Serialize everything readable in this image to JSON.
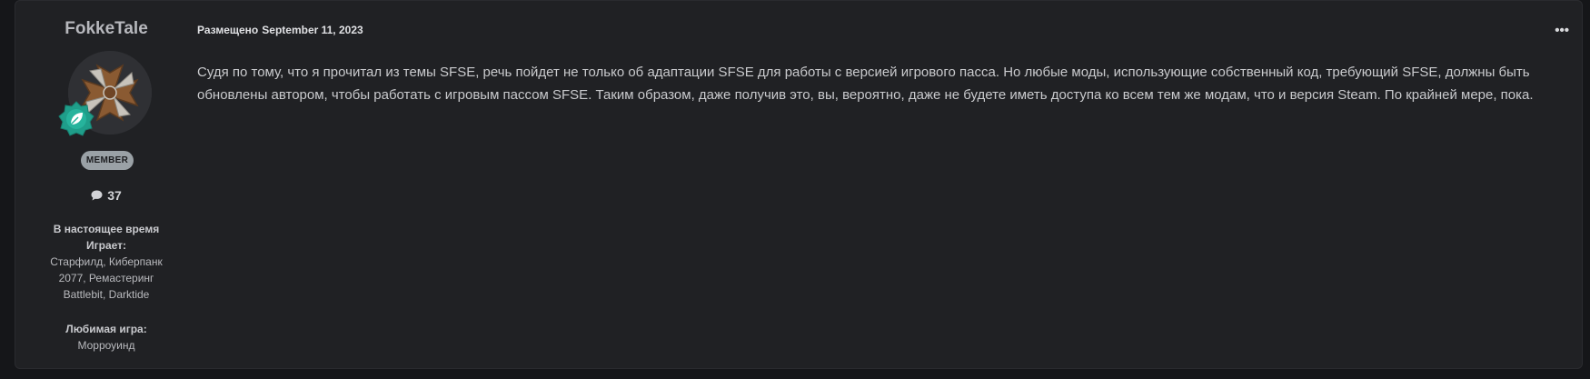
{
  "author": {
    "name": "FokkeTale",
    "avatar_icon": "ornate-cross-avatar",
    "badge_icon": "leaf-badge-icon",
    "badge_color": "#1f9e8a",
    "rank": "MEMBER",
    "post_count_icon": "comment-icon",
    "post_count": "37",
    "fields": [
      {
        "label": "В настоящее время Играет:",
        "value": "Старфилд, Киберпанк 2077, Ремастеринг Battlebit, Darktide"
      },
      {
        "label": "Любимая игра:",
        "value": "Морроуинд"
      }
    ]
  },
  "post": {
    "posted_prefix": "Размещено",
    "date": "September 11, 2023",
    "menu_icon": "more-options-icon",
    "menu_label": "•••",
    "body": "Судя по тому, что я прочитал из темы SFSE, речь пойдет не только об адаптации SFSE для работы с версией игрового пасса. Но любые моды, использующие собственный код, требующий SFSE, должны быть обновлены автором, чтобы работать с игровым пассом SFSE. Таким образом, даже получив это, вы, вероятно, даже не будете иметь доступа ко всем тем же модам, что и версия Steam. По крайней мере, пока."
  },
  "colors": {
    "page_bg": "#151619",
    "card_bg": "#202124",
    "rank_bg": "#9aa1a6"
  }
}
